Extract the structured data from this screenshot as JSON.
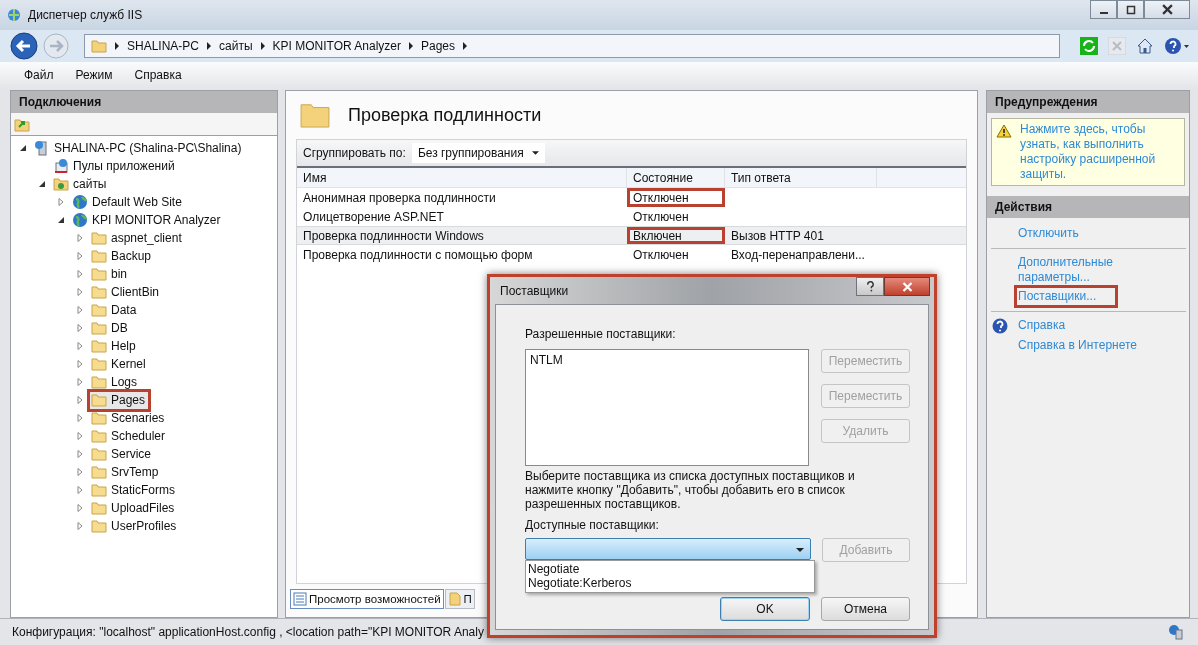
{
  "window": {
    "title": "Диспетчер служб IIS"
  },
  "breadcrumb": [
    "SHALINA-PC",
    "сайты",
    "KPI MONITOR Analyzer",
    "Pages"
  ],
  "menu": [
    "Файл",
    "Режим",
    "Справка"
  ],
  "connections": {
    "title": "Подключения",
    "tree": [
      {
        "label": "SHALINA-PC (Shalina-PC\\Shalina)",
        "kind": "server",
        "expanded": true,
        "selected": false,
        "highlighted": false,
        "children": [
          {
            "label": "Пулы приложений",
            "kind": "pool",
            "selected": false,
            "highlighted": false
          },
          {
            "label": "сайты",
            "kind": "sites",
            "expanded": true,
            "selected": false,
            "highlighted": false,
            "children": [
              {
                "label": "Default Web Site",
                "kind": "globe",
                "expanded": false,
                "selected": false,
                "highlighted": false
              },
              {
                "label": "KPI MONITOR Analyzer",
                "kind": "globe",
                "expanded": true,
                "selected": false,
                "highlighted": false,
                "children": [
                  {
                    "label": "aspnet_client",
                    "kind": "folder",
                    "expanded": false,
                    "selected": false,
                    "highlighted": false
                  },
                  {
                    "label": "Backup",
                    "kind": "folder",
                    "expanded": false,
                    "selected": false,
                    "highlighted": false
                  },
                  {
                    "label": "bin",
                    "kind": "folder",
                    "expanded": false,
                    "selected": false,
                    "highlighted": false
                  },
                  {
                    "label": "ClientBin",
                    "kind": "folder",
                    "expanded": false,
                    "selected": false,
                    "highlighted": false
                  },
                  {
                    "label": "Data",
                    "kind": "folder",
                    "expanded": false,
                    "selected": false,
                    "highlighted": false
                  },
                  {
                    "label": "DB",
                    "kind": "folder",
                    "expanded": false,
                    "selected": false,
                    "highlighted": false
                  },
                  {
                    "label": "Help",
                    "kind": "folder",
                    "expanded": false,
                    "selected": false,
                    "highlighted": false
                  },
                  {
                    "label": "Kernel",
                    "kind": "folder",
                    "expanded": false,
                    "selected": false,
                    "highlighted": false
                  },
                  {
                    "label": "Logs",
                    "kind": "folder",
                    "expanded": false,
                    "selected": false,
                    "highlighted": false
                  },
                  {
                    "label": "Pages",
                    "kind": "folder",
                    "expanded": false,
                    "selected": true,
                    "highlighted": true
                  },
                  {
                    "label": "Scenaries",
                    "kind": "folder",
                    "expanded": false,
                    "selected": false,
                    "highlighted": false
                  },
                  {
                    "label": "Scheduler",
                    "kind": "folder",
                    "expanded": false,
                    "selected": false,
                    "highlighted": false
                  },
                  {
                    "label": "Service",
                    "kind": "folder",
                    "expanded": false,
                    "selected": false,
                    "highlighted": false
                  },
                  {
                    "label": "SrvTemp",
                    "kind": "folder",
                    "expanded": false,
                    "selected": false,
                    "highlighted": false
                  },
                  {
                    "label": "StaticForms",
                    "kind": "folder",
                    "expanded": false,
                    "selected": false,
                    "highlighted": false
                  },
                  {
                    "label": "UploadFiles",
                    "kind": "folder",
                    "expanded": false,
                    "selected": false,
                    "highlighted": false
                  },
                  {
                    "label": "UserProfiles",
                    "kind": "folder",
                    "expanded": false,
                    "selected": false,
                    "highlighted": false
                  }
                ]
              }
            ]
          }
        ]
      }
    ]
  },
  "feature": {
    "title": "Проверка подлинности",
    "group_by_label": "Сгруппировать по:",
    "group_by_value": "Без группирования",
    "table": {
      "columns": [
        "Имя",
        "Состояние",
        "Тип ответа"
      ],
      "rows": [
        {
          "cells": [
            "Анонимная проверка подлинности",
            "Отключен",
            ""
          ],
          "selected": false,
          "highlighted": true
        },
        {
          "cells": [
            "Олицетворение ASP.NET",
            "Отключен",
            ""
          ],
          "selected": false,
          "highlighted": false
        },
        {
          "cells": [
            "Проверка подлинности Windows",
            "Включен",
            "Вызов HTTP 401"
          ],
          "selected": true,
          "highlighted": true
        },
        {
          "cells": [
            "Проверка подлинности с помощью форм",
            "Отключен",
            "Вход-перенаправлени..."
          ],
          "selected": false,
          "highlighted": false
        }
      ]
    },
    "view_tabs": [
      {
        "label": "Просмотр возможностей",
        "selected": true
      },
      {
        "label": "П",
        "selected": false
      }
    ]
  },
  "alerts": {
    "title": "Предупреждения",
    "message": "Нажмите здесь, чтобы узнать, как выполнить настройку расширенной защиты."
  },
  "actions": {
    "title": "Действия",
    "groups": [
      [
        {
          "label": "Отключить",
          "highlighted": false
        }
      ],
      [
        {
          "label": "Дополнительные параметры...",
          "highlighted": false
        },
        {
          "label": "Поставщики...",
          "highlighted": true
        }
      ],
      [
        {
          "label": "Справка",
          "highlighted": false,
          "help_icon": true
        },
        {
          "label": "Справка в Интернете",
          "highlighted": false,
          "help_icon": false
        }
      ]
    ]
  },
  "status_bar": "Конфигурация: \"localhost\" applicationHost.config , <location path=\"KPI MONITOR Analy",
  "dialog": {
    "title": "Поставщики",
    "enabled_label": "Разрешенные поставщики:",
    "enabled": [
      "NTLM"
    ],
    "side_buttons": [
      {
        "label": "Переместить",
        "disabled": true
      },
      {
        "label": "Переместить",
        "disabled": true
      },
      {
        "label": "Удалить",
        "disabled": true
      }
    ],
    "hint": "Выберите поставщика из списка доступных поставщиков и нажмите кнопку \"Добавить\", чтобы добавить его в список разрешенных поставщиков.",
    "available_label": "Доступные поставщики:",
    "dropdown_open": true,
    "available": [
      "Negotiate",
      "Negotiate:Kerberos"
    ],
    "add_button": {
      "label": "Добавить",
      "disabled": true
    },
    "ok": "OK",
    "cancel": "Отмена"
  }
}
